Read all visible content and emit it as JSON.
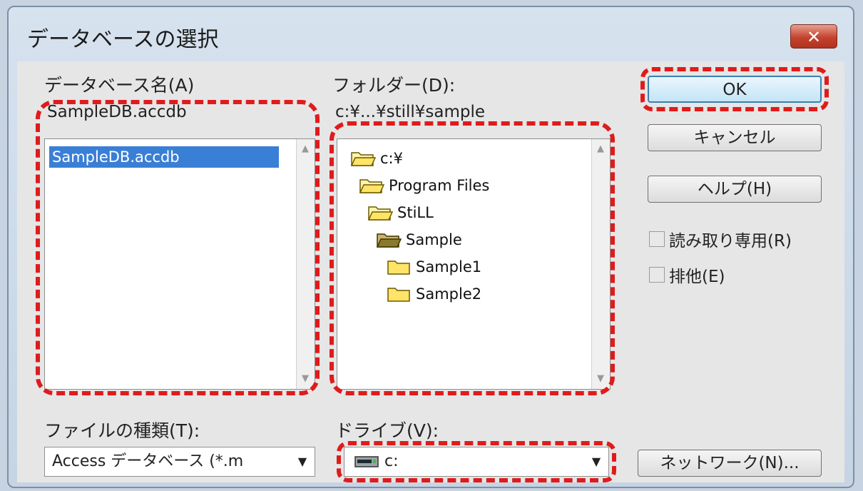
{
  "dialog": {
    "title": "データベースの選択",
    "close_label": "✕"
  },
  "database_name": {
    "label": "データベース名(A)",
    "value": "SampleDB.accdb",
    "items": [
      "SampleDB.accdb"
    ]
  },
  "folder": {
    "label": "フォルダー(D):",
    "path": "c:¥...¥still¥sample",
    "tree": [
      {
        "label": "c:¥",
        "state": "open"
      },
      {
        "label": "Program Files",
        "state": "open"
      },
      {
        "label": "StiLL",
        "state": "open"
      },
      {
        "label": "Sample",
        "state": "current"
      },
      {
        "label": "Sample1",
        "state": "closed"
      },
      {
        "label": "Sample2",
        "state": "closed"
      }
    ]
  },
  "buttons": {
    "ok": "OK",
    "cancel": "キャンセル",
    "help": "ヘルプ(H)",
    "network": "ネットワーク(N)..."
  },
  "options": {
    "readonly": "読み取り専用(R)",
    "exclusive": "排他(E)"
  },
  "file_type": {
    "label": "ファイルの種類(T):",
    "value": "Access データベース (*.m"
  },
  "drive": {
    "label": "ドライブ(V):",
    "value": "c:"
  },
  "colors": {
    "highlight": "#e01b1b",
    "selection": "#3a7fd6"
  }
}
